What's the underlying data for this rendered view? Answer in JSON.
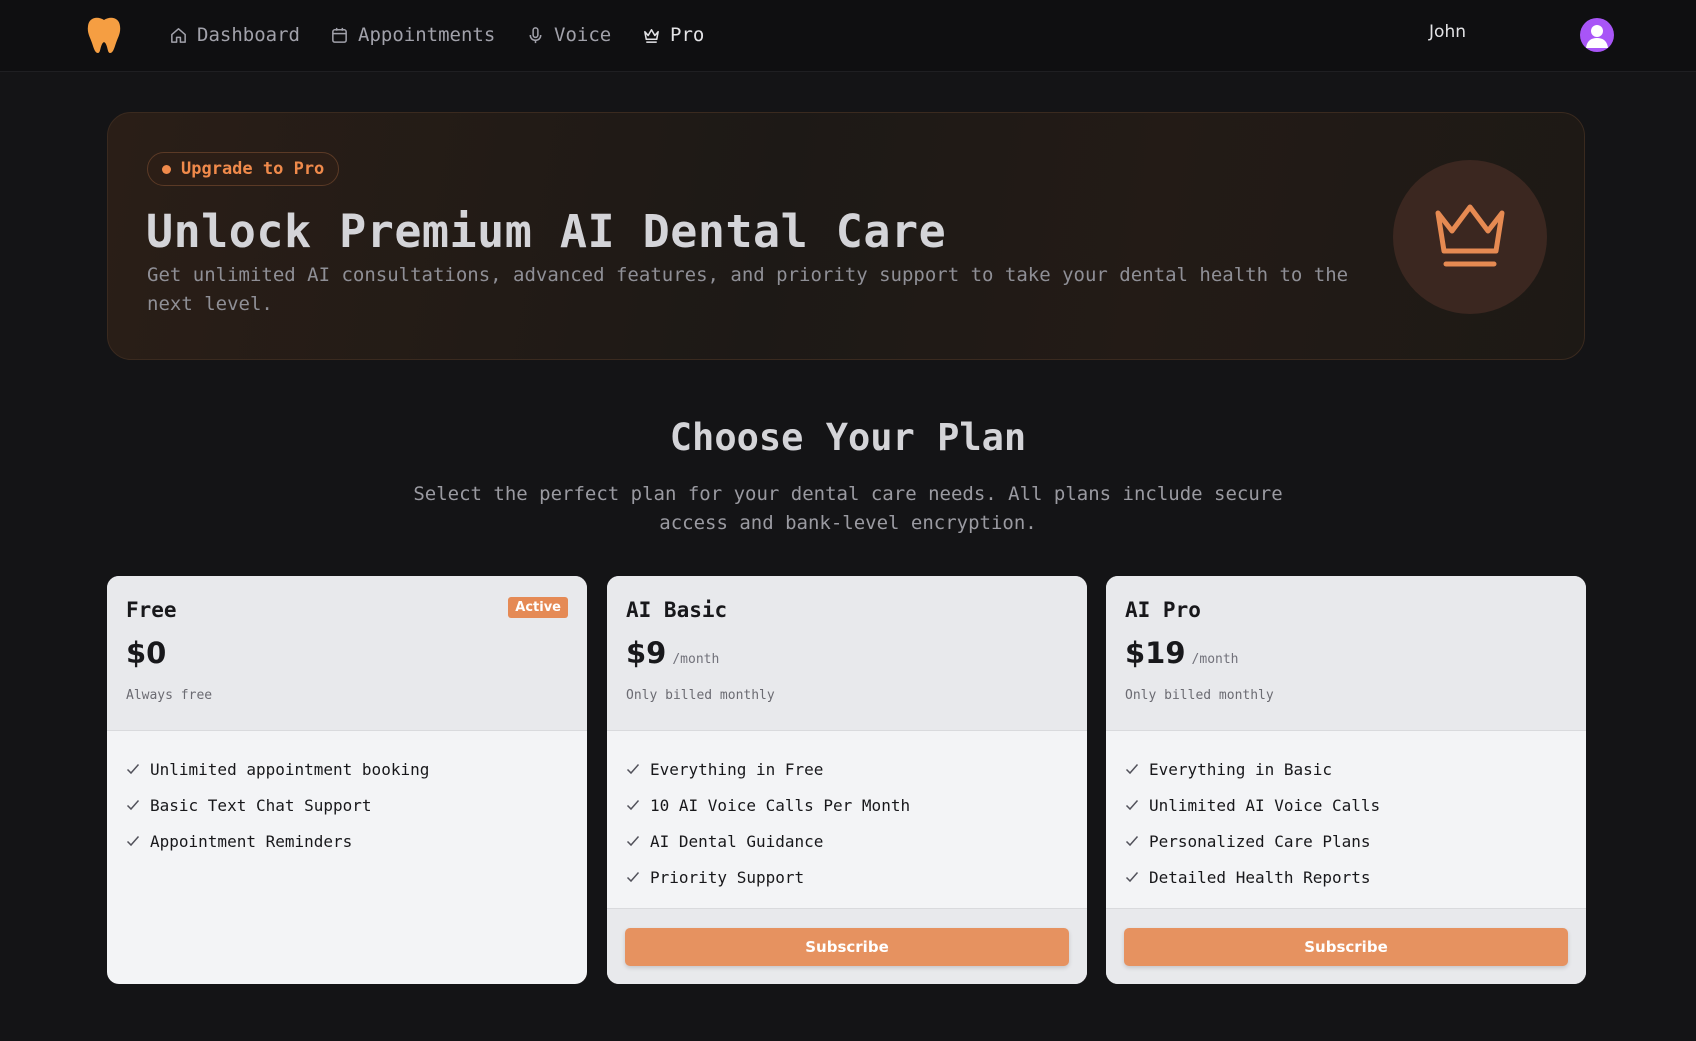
{
  "nav": {
    "items": [
      {
        "label": "Dashboard",
        "icon": "home-icon"
      },
      {
        "label": "Appointments",
        "icon": "calendar-icon"
      },
      {
        "label": "Voice",
        "icon": "microphone-icon"
      },
      {
        "label": "Pro",
        "icon": "crown-icon",
        "active": true
      }
    ],
    "user_name": "John"
  },
  "hero": {
    "badge": "Upgrade to Pro",
    "title": "Unlock Premium AI Dental Care",
    "description": "Get unlimited AI consultations, advanced features, and priority support to take your dental health to the next level."
  },
  "plans_section": {
    "title": "Choose Your Plan",
    "description": "Select the perfect plan for your dental care needs. All plans include secure access and bank-level encryption."
  },
  "plans": [
    {
      "name": "Free",
      "badge": "Active",
      "price": "$0",
      "period": "",
      "billing": "Always free",
      "features": [
        "Unlimited appointment booking",
        "Basic Text Chat Support",
        "Appointment Reminders"
      ]
    },
    {
      "name": "AI Basic",
      "price": "$9",
      "period": "/month",
      "billing": "Only billed monthly",
      "features": [
        "Everything in Free",
        "10 AI Voice Calls Per Month",
        "AI Dental Guidance",
        "Priority Support"
      ],
      "button": "Subscribe"
    },
    {
      "name": "AI Pro",
      "price": "$19",
      "period": "/month",
      "billing": "Only billed monthly",
      "features": [
        "Everything in Basic",
        "Unlimited AI Voice Calls",
        "Personalized Care Plans",
        "Detailed Health Reports"
      ],
      "button": "Subscribe"
    }
  ],
  "colors": {
    "accent": "#e69260",
    "logo": "#f59e42",
    "avatar": "#a855f7"
  }
}
